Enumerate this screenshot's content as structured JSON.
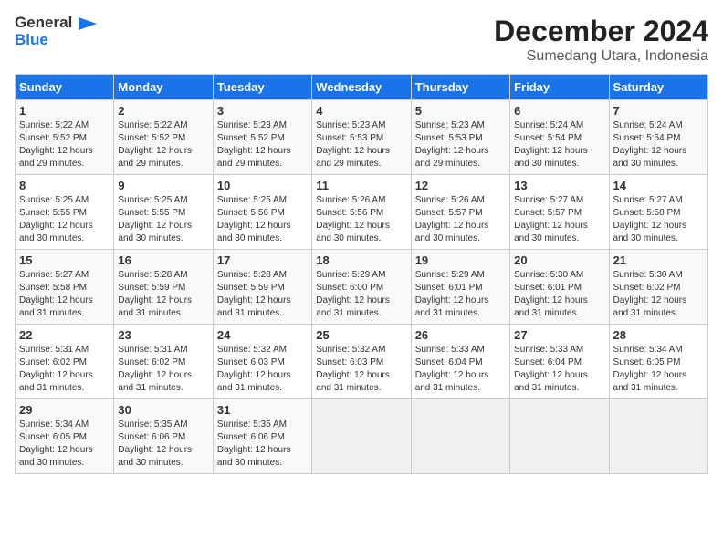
{
  "logo": {
    "line1": "General",
    "line2": "Blue"
  },
  "title": "December 2024",
  "location": "Sumedang Utara, Indonesia",
  "days_of_week": [
    "Sunday",
    "Monday",
    "Tuesday",
    "Wednesday",
    "Thursday",
    "Friday",
    "Saturday"
  ],
  "weeks": [
    [
      {
        "day": "1",
        "sunrise": "5:22 AM",
        "sunset": "5:52 PM",
        "daylight": "12 hours and 29 minutes."
      },
      {
        "day": "2",
        "sunrise": "5:22 AM",
        "sunset": "5:52 PM",
        "daylight": "12 hours and 29 minutes."
      },
      {
        "day": "3",
        "sunrise": "5:23 AM",
        "sunset": "5:52 PM",
        "daylight": "12 hours and 29 minutes."
      },
      {
        "day": "4",
        "sunrise": "5:23 AM",
        "sunset": "5:53 PM",
        "daylight": "12 hours and 29 minutes."
      },
      {
        "day": "5",
        "sunrise": "5:23 AM",
        "sunset": "5:53 PM",
        "daylight": "12 hours and 29 minutes."
      },
      {
        "day": "6",
        "sunrise": "5:24 AM",
        "sunset": "5:54 PM",
        "daylight": "12 hours and 30 minutes."
      },
      {
        "day": "7",
        "sunrise": "5:24 AM",
        "sunset": "5:54 PM",
        "daylight": "12 hours and 30 minutes."
      }
    ],
    [
      {
        "day": "8",
        "sunrise": "5:25 AM",
        "sunset": "5:55 PM",
        "daylight": "12 hours and 30 minutes."
      },
      {
        "day": "9",
        "sunrise": "5:25 AM",
        "sunset": "5:55 PM",
        "daylight": "12 hours and 30 minutes."
      },
      {
        "day": "10",
        "sunrise": "5:25 AM",
        "sunset": "5:56 PM",
        "daylight": "12 hours and 30 minutes."
      },
      {
        "day": "11",
        "sunrise": "5:26 AM",
        "sunset": "5:56 PM",
        "daylight": "12 hours and 30 minutes."
      },
      {
        "day": "12",
        "sunrise": "5:26 AM",
        "sunset": "5:57 PM",
        "daylight": "12 hours and 30 minutes."
      },
      {
        "day": "13",
        "sunrise": "5:27 AM",
        "sunset": "5:57 PM",
        "daylight": "12 hours and 30 minutes."
      },
      {
        "day": "14",
        "sunrise": "5:27 AM",
        "sunset": "5:58 PM",
        "daylight": "12 hours and 30 minutes."
      }
    ],
    [
      {
        "day": "15",
        "sunrise": "5:27 AM",
        "sunset": "5:58 PM",
        "daylight": "12 hours and 31 minutes."
      },
      {
        "day": "16",
        "sunrise": "5:28 AM",
        "sunset": "5:59 PM",
        "daylight": "12 hours and 31 minutes."
      },
      {
        "day": "17",
        "sunrise": "5:28 AM",
        "sunset": "5:59 PM",
        "daylight": "12 hours and 31 minutes."
      },
      {
        "day": "18",
        "sunrise": "5:29 AM",
        "sunset": "6:00 PM",
        "daylight": "12 hours and 31 minutes."
      },
      {
        "day": "19",
        "sunrise": "5:29 AM",
        "sunset": "6:01 PM",
        "daylight": "12 hours and 31 minutes."
      },
      {
        "day": "20",
        "sunrise": "5:30 AM",
        "sunset": "6:01 PM",
        "daylight": "12 hours and 31 minutes."
      },
      {
        "day": "21",
        "sunrise": "5:30 AM",
        "sunset": "6:02 PM",
        "daylight": "12 hours and 31 minutes."
      }
    ],
    [
      {
        "day": "22",
        "sunrise": "5:31 AM",
        "sunset": "6:02 PM",
        "daylight": "12 hours and 31 minutes."
      },
      {
        "day": "23",
        "sunrise": "5:31 AM",
        "sunset": "6:02 PM",
        "daylight": "12 hours and 31 minutes."
      },
      {
        "day": "24",
        "sunrise": "5:32 AM",
        "sunset": "6:03 PM",
        "daylight": "12 hours and 31 minutes."
      },
      {
        "day": "25",
        "sunrise": "5:32 AM",
        "sunset": "6:03 PM",
        "daylight": "12 hours and 31 minutes."
      },
      {
        "day": "26",
        "sunrise": "5:33 AM",
        "sunset": "6:04 PM",
        "daylight": "12 hours and 31 minutes."
      },
      {
        "day": "27",
        "sunrise": "5:33 AM",
        "sunset": "6:04 PM",
        "daylight": "12 hours and 31 minutes."
      },
      {
        "day": "28",
        "sunrise": "5:34 AM",
        "sunset": "6:05 PM",
        "daylight": "12 hours and 31 minutes."
      }
    ],
    [
      {
        "day": "29",
        "sunrise": "5:34 AM",
        "sunset": "6:05 PM",
        "daylight": "12 hours and 30 minutes."
      },
      {
        "day": "30",
        "sunrise": "5:35 AM",
        "sunset": "6:06 PM",
        "daylight": "12 hours and 30 minutes."
      },
      {
        "day": "31",
        "sunrise": "5:35 AM",
        "sunset": "6:06 PM",
        "daylight": "12 hours and 30 minutes."
      },
      null,
      null,
      null,
      null
    ]
  ],
  "labels": {
    "sunrise": "Sunrise:",
    "sunset": "Sunset:",
    "daylight": "Daylight:"
  }
}
